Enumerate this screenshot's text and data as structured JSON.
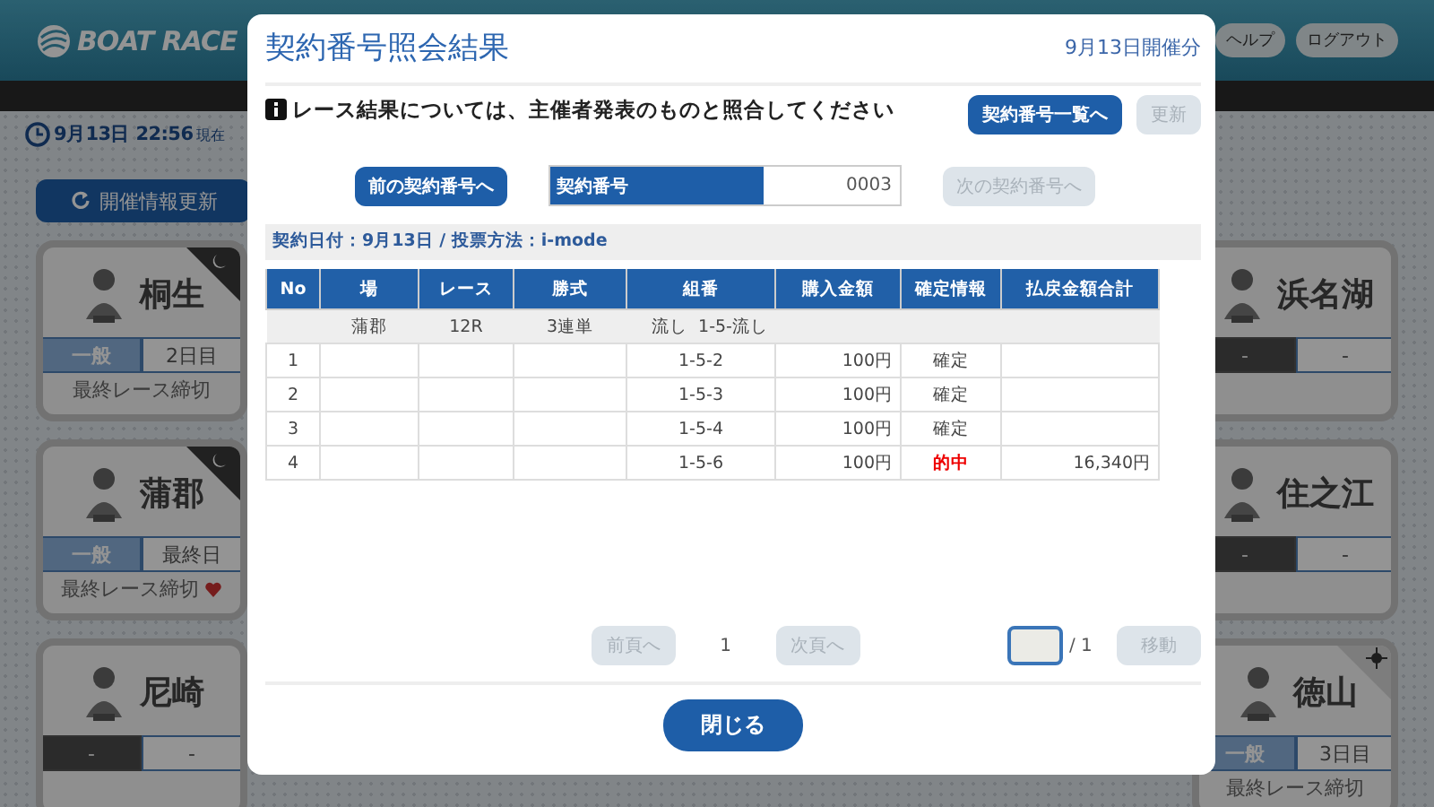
{
  "header": {
    "logo": "BOAT RACE",
    "buttons": [
      {
        "label": "ヘルプ"
      },
      {
        "label": "ログアウト"
      }
    ]
  },
  "status": {
    "date_time": "9月13日 22:56",
    "suffix": "現在"
  },
  "refresh_button": "開催情報更新",
  "left_column": [
    {
      "name": "桐生",
      "night_race": true,
      "badges": [
        {
          "label": "一般",
          "kind": "grade"
        },
        {
          "label": "2日目",
          "kind": "day"
        }
      ],
      "deadline": "最終レース締切",
      "favorite": false
    },
    {
      "name": "蒲郡",
      "night_race": true,
      "badges": [
        {
          "label": "一般",
          "kind": "grade"
        },
        {
          "label": "最終日",
          "kind": "day"
        }
      ],
      "deadline": "最終レース締切",
      "favorite": true
    },
    {
      "name": "尼崎",
      "badges": [
        {
          "label": "-",
          "kind": "none"
        },
        {
          "label": "-",
          "kind": "day"
        }
      ],
      "favorite": false
    }
  ],
  "right_column": [
    {
      "name": "浜名湖",
      "badges": [
        {
          "label": "-",
          "kind": "none"
        },
        {
          "label": "-",
          "kind": "day"
        }
      ],
      "favorite": false
    },
    {
      "name": "住之江",
      "badges": [
        {
          "label": "-",
          "kind": "none"
        },
        {
          "label": "-",
          "kind": "day"
        }
      ],
      "favorite": false
    },
    {
      "name": "徳山",
      "morning_race": true,
      "badges": [
        {
          "label": "一般",
          "kind": "grade"
        },
        {
          "label": "3日目",
          "kind": "day"
        }
      ],
      "deadline": "最終レース締切",
      "favorite": false
    }
  ],
  "modal": {
    "title": "契約番号照会結果",
    "date_note": "9月13日開催分",
    "notice": "レース結果については、主催者発表のものと照合してください",
    "actions": [
      {
        "label": "契約番号一覧へ",
        "disabled": false
      },
      {
        "label": "更新",
        "disabled": true
      }
    ],
    "prev_contract": {
      "label": "前の契約番号へ",
      "disabled": false
    },
    "contract_field": {
      "label": "契約番号",
      "value": "0003"
    },
    "next_contract": {
      "label": "次の契約番号へ",
      "disabled": true
    },
    "info": "契約日付：9月13日 / 投票方法：i-mode",
    "table": {
      "columns": [
        "No",
        "場",
        "レース",
        "勝式",
        "組番",
        "購入金額",
        "確定情報",
        "払戻金額合計"
      ],
      "summary": {
        "venue": "蒲郡",
        "race": "12R",
        "type": "3連単",
        "combo": "流し  1-5-流し"
      },
      "rows": [
        {
          "no": "1",
          "combo": "1-5-2",
          "amount": "100円",
          "result": "確定",
          "hit": false
        },
        {
          "no": "2",
          "combo": "1-5-3",
          "amount": "100円",
          "result": "確定",
          "hit": false
        },
        {
          "no": "3",
          "combo": "1-5-4",
          "amount": "100円",
          "result": "確定",
          "hit": false
        },
        {
          "no": "4",
          "combo": "1-5-6",
          "amount": "100円",
          "result": "的中",
          "hit": true,
          "payout": "16,340円"
        }
      ]
    },
    "pagination": {
      "prev": {
        "label": "前頁へ",
        "disabled": true
      },
      "current": "1",
      "next": {
        "label": "次頁へ",
        "disabled": true
      },
      "total": "/ 1",
      "go": {
        "label": "移動",
        "disabled": true
      }
    },
    "close_button": "閉じる"
  }
}
